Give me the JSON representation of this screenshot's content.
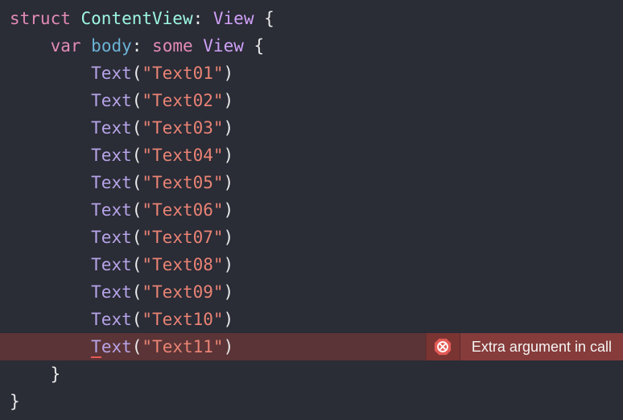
{
  "code": {
    "kw_struct": "struct",
    "type_name": "ContentView",
    "colon_space": ": ",
    "protocol_name": "View",
    "brace_open": " {",
    "kw_var": "var",
    "member_body": "body",
    "kw_some": "some",
    "type_view": "View",
    "call_name": "Text",
    "paren_open": "(",
    "paren_close": ")",
    "strings": [
      "\"Text01\"",
      "\"Text02\"",
      "\"Text03\"",
      "\"Text04\"",
      "\"Text05\"",
      "\"Text06\"",
      "\"Text07\"",
      "\"Text08\"",
      "\"Text09\"",
      "\"Text10\"",
      "\"Text11\""
    ],
    "brace_close_inner": "}",
    "brace_close_outer": "}",
    "err_first_char": "T",
    "err_rest": "ext"
  },
  "error": {
    "message": "Extra argument in call"
  }
}
